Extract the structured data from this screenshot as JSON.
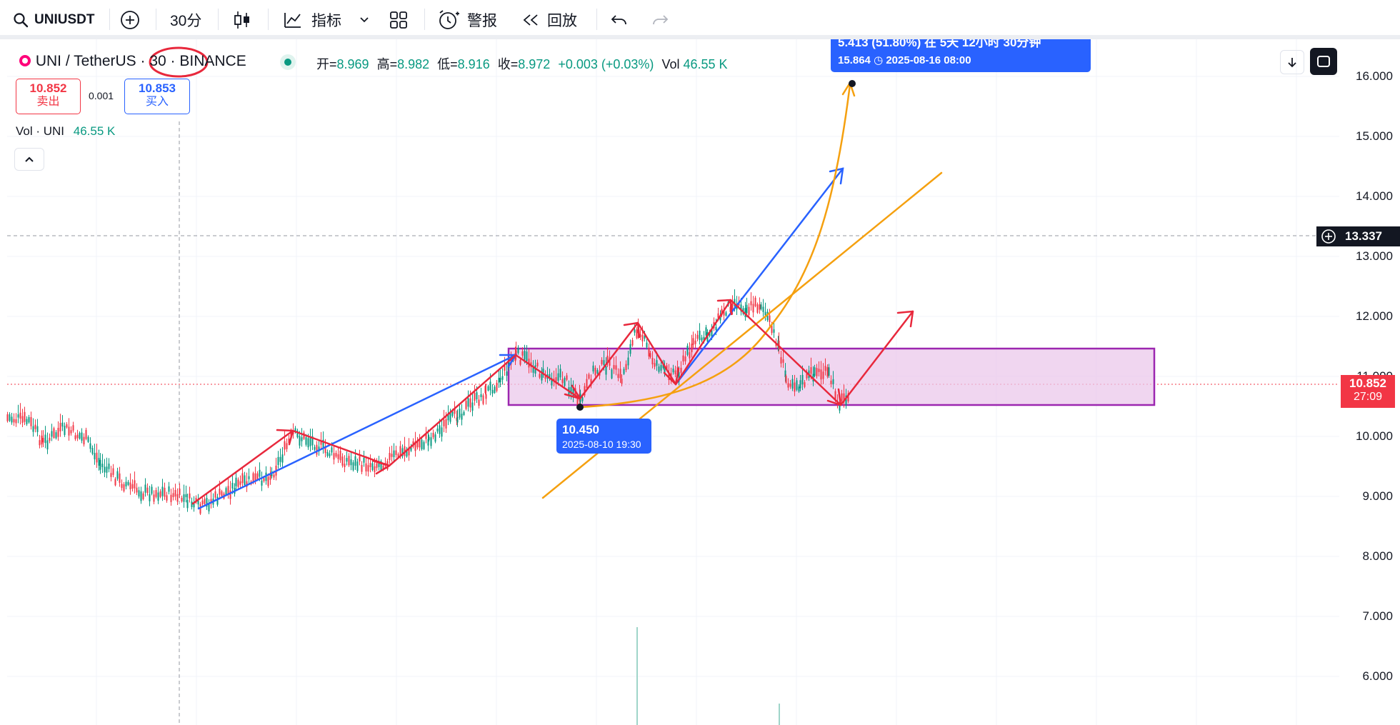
{
  "toolbar": {
    "symbol": "UNIUSDT",
    "interval": "30分",
    "indicators_label": "指标",
    "alert_label": "警报",
    "replay_label": "回放"
  },
  "header": {
    "symbol_title": "UNI / TetherUS",
    "interval": "30",
    "exchange": "BINANCE",
    "open_label": "开=",
    "open_value": "8.969",
    "high_label": "高=",
    "high_value": "8.982",
    "low_label": "低=",
    "low_value": "8.916",
    "close_label": "收=",
    "close_value": "8.972",
    "change": "+0.003 (+0.03%)",
    "vol_label": "Vol",
    "vol_value": "46.55 K"
  },
  "trade": {
    "sell_price": "10.852",
    "sell_label": "卖出",
    "spread": "0.001",
    "buy_price": "10.853",
    "buy_label": "买入"
  },
  "volume_legend": {
    "name": "Vol · UNI",
    "value": "46.55 K"
  },
  "price_axis": {
    "labels": [
      "16.000",
      "15.000",
      "14.000",
      "13.000",
      "12.000",
      "11.000",
      "10.000",
      "9.000",
      "8.000",
      "7.000",
      "6.000"
    ],
    "crosshair_price": "13.337",
    "last_price": "10.852",
    "countdown": "27:09"
  },
  "annotations": {
    "low_tooltip_price": "10.450",
    "low_tooltip_time": "2025-08-10 19:30",
    "target_tooltip_top": "5.413 (51.80%) 在 5天 12小时 30分钟",
    "target_tooltip_price": "15.864",
    "target_tooltip_time": "2025-08-16  08:00"
  },
  "colors": {
    "up": "#089981",
    "down": "#f23645",
    "accent": "#2962ff",
    "orange": "#f5a00f",
    "red_arrow": "#e8283c",
    "purple_box": "#9c27b0"
  }
}
